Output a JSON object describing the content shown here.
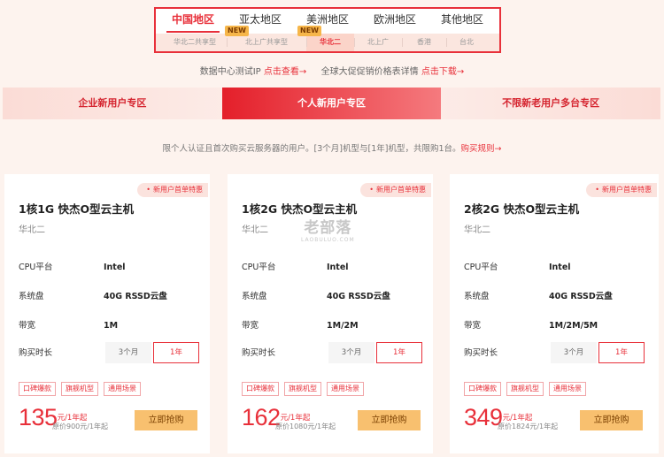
{
  "regions": {
    "tabs": [
      "中国地区",
      "亚太地区",
      "美洲地区",
      "欧洲地区",
      "其他地区"
    ],
    "active_index": 0,
    "sub_tabs": [
      "华北二共享型",
      "北上广共享型",
      "华北二",
      "北上广",
      "香港",
      "台北"
    ],
    "active_sub_index": 2,
    "new_badge": "NEW"
  },
  "links_row": {
    "text1": "数据中心测试IP",
    "link1": "点击查看→",
    "text2": "全球大促促销价格表详情",
    "link2": "点击下载→"
  },
  "user_tabs": [
    "企业新用户专区",
    "个人新用户专区",
    "不限新老用户多台专区"
  ],
  "active_user_tab": 1,
  "notice": {
    "text": "限个人认证且首次购买云服务器的用户。[3个月]机型与[1年]机型，共限购1台。",
    "link": "购买规则→"
  },
  "watermark": {
    "main": "老部落",
    "sub": "LAOBULUO.COM"
  },
  "cards": [
    {
      "badge": "新用户首单特惠",
      "title": "1核1G 快杰O型云主机",
      "region": "华北二",
      "cpu_label": "CPU平台",
      "cpu": "Intel",
      "disk_label": "系统盘",
      "disk": "40G RSSD云盘",
      "bw_label": "带宽",
      "bw": "1M",
      "duration_label": "购买时长",
      "opt1": "3个月",
      "opt2": "1年",
      "tags": [
        "口碑爆款",
        "旗舰机型",
        "通用场景"
      ],
      "price": "135",
      "price_unit": "元/1年起",
      "original": "原价900元/1年起",
      "buy": "立即抢购"
    },
    {
      "badge": "新用户首单特惠",
      "title": "1核2G 快杰O型云主机",
      "region": "华北二",
      "cpu_label": "CPU平台",
      "cpu": "Intel",
      "disk_label": "系统盘",
      "disk": "40G RSSD云盘",
      "bw_label": "带宽",
      "bw": "1M/2M",
      "duration_label": "购买时长",
      "opt1": "3个月",
      "opt2": "1年",
      "tags": [
        "口碑爆款",
        "旗舰机型",
        "通用场景"
      ],
      "price": "162",
      "price_unit": "元/1年起",
      "original": "原价1080元/1年起",
      "buy": "立即抢购"
    },
    {
      "badge": "新用户首单特惠",
      "title": "2核2G 快杰O型云主机",
      "region": "华北二",
      "cpu_label": "CPU平台",
      "cpu": "Intel",
      "disk_label": "系统盘",
      "disk": "40G RSSD云盘",
      "bw_label": "带宽",
      "bw": "1M/2M/5M",
      "duration_label": "购买时长",
      "opt1": "3个月",
      "opt2": "1年",
      "tags": [
        "口碑爆款",
        "旗舰机型",
        "通用场景"
      ],
      "price": "349",
      "price_unit": "元/1年起",
      "original": "原价1824元/1年起",
      "buy": "立即抢购"
    }
  ]
}
